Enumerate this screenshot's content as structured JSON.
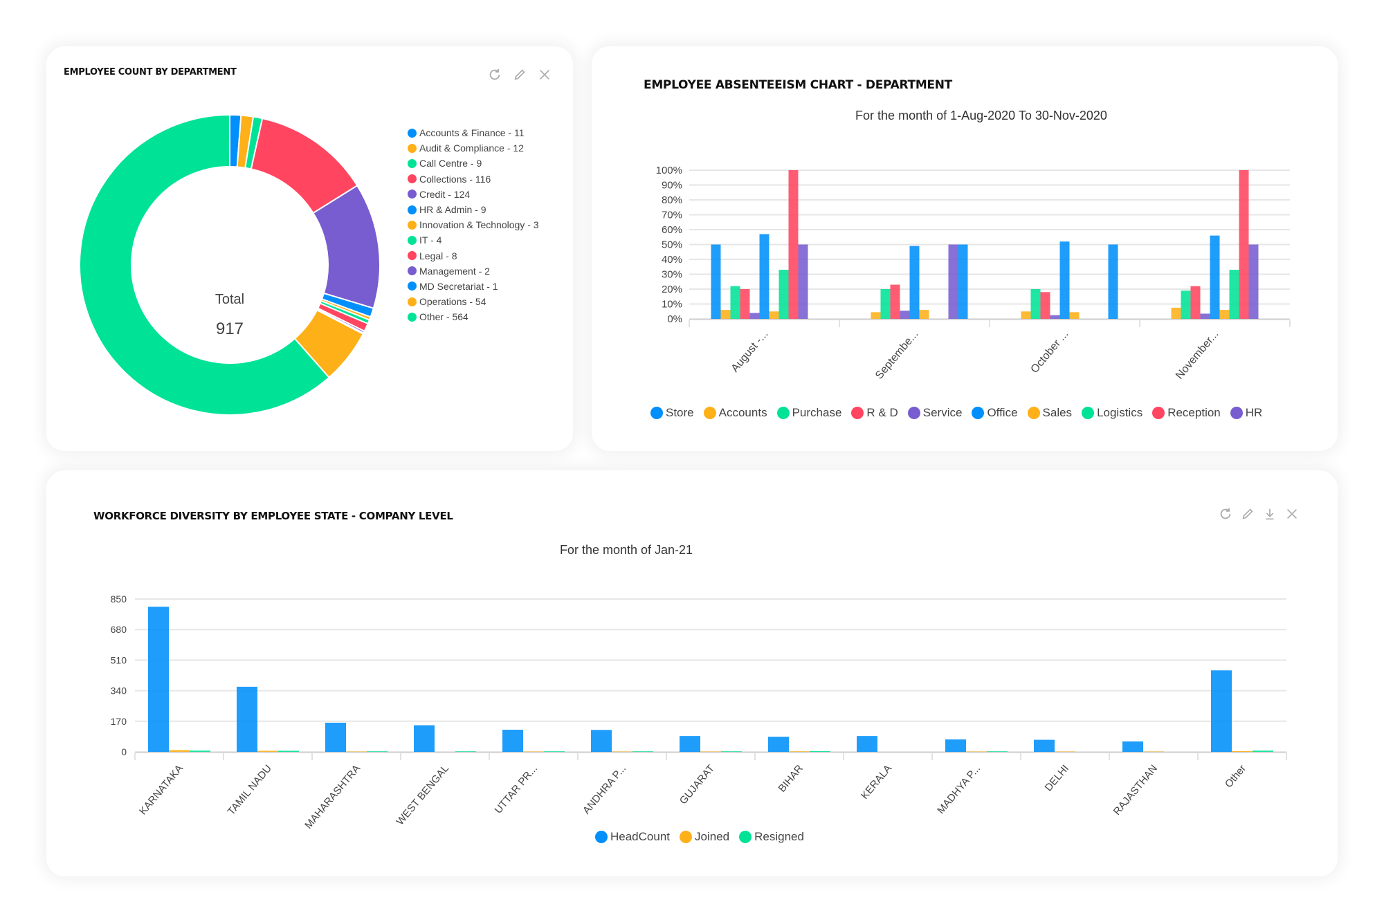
{
  "cards": {
    "donut": {
      "title": "EMPLOYEE COUNT BY DEPARTMENT",
      "icons": [
        "refresh-icon",
        "edit-icon",
        "close-icon"
      ],
      "center_label": "Total",
      "center_value": "917"
    },
    "absenteeism": {
      "title": "EMPLOYEE ABSENTEEISM CHART - DEPARTMENT",
      "subtitle": "For the month of 1-Aug-2020 To 30-Nov-2020"
    },
    "state": {
      "title": "WORKFORCE DIVERSITY BY EMPLOYEE STATE - COMPANY LEVEL",
      "subtitle": "For the month of Jan-21",
      "icons": [
        "refresh-icon",
        "edit-icon",
        "download-icon",
        "close-icon"
      ]
    }
  },
  "colors": {
    "blue": "#008FFB",
    "orange": "#FEB019",
    "green": "#00E396",
    "red": "#FF4560",
    "purple": "#775DD0"
  },
  "chart_data": [
    {
      "type": "pie",
      "subtype": "donut",
      "title": "EMPLOYEE COUNT BY DEPARTMENT",
      "total": 917,
      "legend_position": "right",
      "slices": [
        {
          "label": "Accounts & Finance",
          "value": 11,
          "color": "#008FFB",
          "legend": "Accounts & Finance - 11"
        },
        {
          "label": "Audit & Compliance",
          "value": 12,
          "color": "#FEB019",
          "legend": "Audit & Compliance - 12"
        },
        {
          "label": "Call Centre",
          "value": 9,
          "color": "#00E396",
          "legend": "Call Centre - 9"
        },
        {
          "label": "Collections",
          "value": 116,
          "color": "#FF4560",
          "legend": "Collections - 116"
        },
        {
          "label": "Credit",
          "value": 124,
          "color": "#775DD0",
          "legend": "Credit - 124"
        },
        {
          "label": "HR & Admin",
          "value": 9,
          "color": "#008FFB",
          "legend": "HR & Admin - 9"
        },
        {
          "label": "Innovation & Technology",
          "value": 3,
          "color": "#FEB019",
          "legend": "Innovation & Technology - 3"
        },
        {
          "label": "IT",
          "value": 4,
          "color": "#00E396",
          "legend": "IT - 4"
        },
        {
          "label": "Legal",
          "value": 8,
          "color": "#FF4560",
          "legend": "Legal - 8"
        },
        {
          "label": "Management",
          "value": 2,
          "color": "#775DD0",
          "legend": "Management - 2"
        },
        {
          "label": "MD Secretariat",
          "value": 1,
          "color": "#008FFB",
          "legend": "MD Secretariat - 1"
        },
        {
          "label": "Operations",
          "value": 54,
          "color": "#FEB019",
          "legend": "Operations - 54"
        },
        {
          "label": "Other",
          "value": 564,
          "color": "#00E396",
          "legend": "Other - 564"
        }
      ]
    },
    {
      "type": "bar",
      "title": "EMPLOYEE ABSENTEEISM CHART - DEPARTMENT",
      "subtitle": "For the month of 1-Aug-2020 To 30-Nov-2020",
      "categories": [
        "August -...",
        "Septembe...",
        "October ...",
        "November..."
      ],
      "ylim": [
        0,
        100
      ],
      "yticks": [
        "0%",
        "10%",
        "20%",
        "30%",
        "40%",
        "50%",
        "60%",
        "70%",
        "80%",
        "90%",
        "100%"
      ],
      "grid": true,
      "legend_position": "bottom",
      "series": [
        {
          "name": "Store",
          "color": "#008FFB",
          "values": [
            50,
            0,
            0,
            0
          ]
        },
        {
          "name": "Accounts",
          "color": "#FEB019",
          "values": [
            6,
            4.5,
            5,
            7.5
          ]
        },
        {
          "name": "Purchase",
          "color": "#00E396",
          "values": [
            22,
            20,
            20,
            19
          ]
        },
        {
          "name": "R & D",
          "color": "#FF4560",
          "values": [
            20,
            23,
            18,
            22
          ]
        },
        {
          "name": "Service",
          "color": "#775DD0",
          "values": [
            4,
            5.5,
            2.5,
            3.5
          ]
        },
        {
          "name": "Office",
          "color": "#008FFB",
          "values": [
            57,
            49,
            52,
            56
          ]
        },
        {
          "name": "Sales",
          "color": "#FEB019",
          "values": [
            5,
            6,
            4.5,
            6
          ]
        },
        {
          "name": "Logistics",
          "color": "#00E396",
          "values": [
            33,
            0,
            0,
            33
          ]
        },
        {
          "name": "Reception",
          "color": "#FF4560",
          "values": [
            100,
            0,
            0,
            100
          ]
        },
        {
          "name": "HR",
          "color": "#775DD0",
          "values": [
            50,
            50,
            0,
            50
          ]
        },
        {
          "name": "",
          "color": "#008FFB",
          "values": [
            0,
            50,
            50,
            0
          ],
          "in_legend": false
        }
      ]
    },
    {
      "type": "bar",
      "title": "WORKFORCE DIVERSITY BY EMPLOYEE STATE - COMPANY LEVEL",
      "subtitle": "For the month of Jan-21",
      "categories": [
        "KARNATAKA",
        "TAMIL NADU",
        "MAHARASHTRA",
        "WEST BENGAL",
        "UTTAR PR...",
        "ANDHRA P...",
        "GUJARAT",
        "BIHAR",
        "KERALA",
        "MADHYA P...",
        "DELHI",
        "RAJASTHAN",
        "Other"
      ],
      "ylim": [
        0,
        850
      ],
      "yticks": [
        "0",
        "170",
        "340",
        "510",
        "680",
        "850"
      ],
      "grid": true,
      "legend_position": "bottom",
      "series": [
        {
          "name": "HeadCount",
          "color": "#008FFB",
          "values": [
            807,
            362,
            162,
            148,
            123,
            122,
            88,
            84,
            88,
            69,
            67,
            58,
            453
          ]
        },
        {
          "name": "Joined",
          "color": "#FEB019",
          "values": [
            10,
            6,
            2,
            0,
            2,
            2,
            2,
            3,
            0,
            2,
            2,
            2,
            4
          ]
        },
        {
          "name": "Resigned",
          "color": "#00E396",
          "values": [
            7,
            6,
            3,
            3,
            3,
            3,
            3,
            4,
            0,
            3,
            0,
            0,
            7
          ]
        }
      ]
    }
  ]
}
